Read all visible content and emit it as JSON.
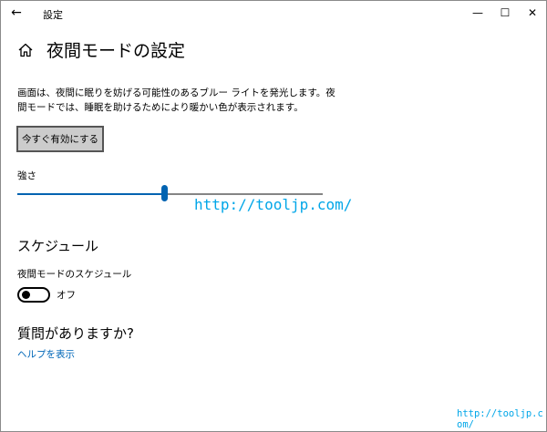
{
  "window": {
    "title": "設定",
    "back_icon": "←",
    "minimize_icon": "—",
    "maximize_icon": "☐",
    "close_icon": "✕"
  },
  "page": {
    "title": "夜間モードの設定",
    "home_icon": "home-icon"
  },
  "description": "画面は、夜間に眠りを妨げる可能性のあるブルー ライトを発光します。夜間モードでは、睡眠を助けるためにより暖かい色が表示されます。",
  "enable_button": {
    "label": "今すぐ有効にする"
  },
  "strength": {
    "label": "強さ",
    "value_fraction": 0.48,
    "accent_color": "#0063b1"
  },
  "schedule": {
    "section_title": "スケジュール",
    "toggle_label": "夜間モードのスケジュール",
    "toggle_state": "オフ",
    "toggle_on": false
  },
  "help": {
    "section_title": "質問がありますか?",
    "link_label": "ヘルプを表示",
    "link_color": "#0067b8"
  },
  "watermarks": {
    "main": "http://tooljp.com/",
    "corner": "http://tooljp.com/"
  }
}
